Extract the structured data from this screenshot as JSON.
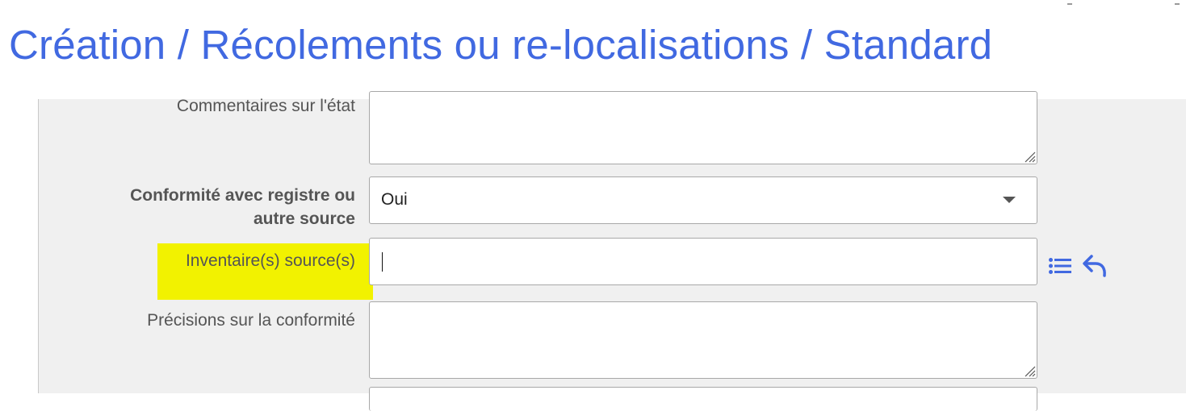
{
  "page": {
    "title": "Création / Récolements ou re-localisations / Standard"
  },
  "form": {
    "etat_comment": {
      "label": "Commentaires sur l'état",
      "value": ""
    },
    "conformite": {
      "label_line1": "Conformité avec registre ou",
      "label_line2": "autre source",
      "selected": "Oui"
    },
    "inventaires_source": {
      "label": "Inventaire(s) source(s)",
      "value": ""
    },
    "precisions_conformite": {
      "label": "Précisions sur la conformité",
      "value": ""
    }
  },
  "icons": {
    "list": "list-icon",
    "undo": "reply-arrow-icon"
  },
  "colors": {
    "accent": "#4169e1",
    "highlight": "#f2f200",
    "panel_bg": "#f0f0f0",
    "label_text": "#555555"
  }
}
